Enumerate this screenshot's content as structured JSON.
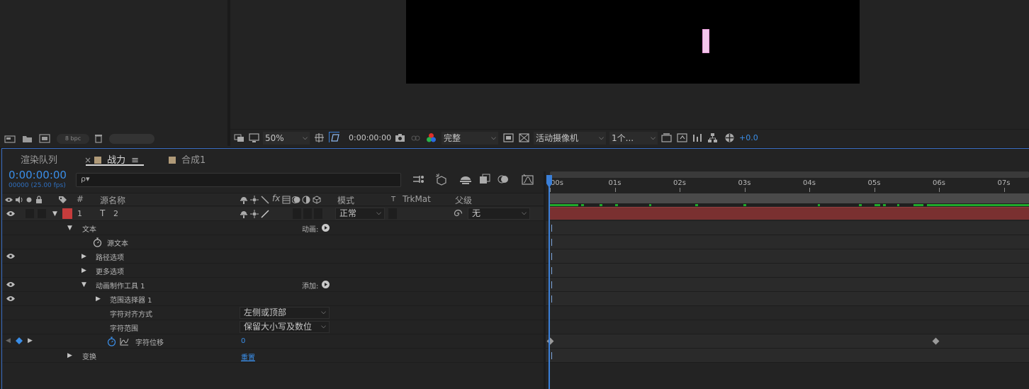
{
  "project": {
    "bpc_label": "8 bpc"
  },
  "viewer": {
    "zoom": "50%",
    "timecode": "0:00:00:00",
    "resolution": "完整",
    "camera": "活动摄像机",
    "views": "1个...",
    "exposure": "+0.0"
  },
  "timeline": {
    "tabs": [
      {
        "label": "渲染队列"
      },
      {
        "label": "战力"
      },
      {
        "label": "合成1"
      }
    ],
    "active_tab_close": "×",
    "active_tab_menu": "≡",
    "timecode": "0:00:00:00",
    "fps": "00000 (25.00 fps)",
    "search_placeholder": "ρ▾",
    "columns": {
      "hash": "#",
      "source_name": "源名称",
      "mode": "模式",
      "t": "T",
      "trkmat": "TrkMat",
      "parent": "父级"
    },
    "layer": {
      "index": "1",
      "type_glyph": "T",
      "name": "2",
      "mode": "正常",
      "parent": "无"
    },
    "rows": {
      "text": "文本",
      "animate_label": "动画:",
      "source_text": "源文本",
      "path_options": "路径选项",
      "more_options": "更多选项",
      "animator": "动画制作工具 1",
      "add_label": "添加:",
      "range_selector": "范围选择器 1",
      "char_alignment": "字符对齐方式",
      "char_alignment_value": "左侧或顶部",
      "char_range": "字符范围",
      "char_range_value": "保留大小写及数位",
      "char_offset": "字符位移",
      "char_offset_value": "0",
      "transform": "变换",
      "reset": "重置"
    },
    "ruler_labels": [
      "00s",
      "01s",
      "02s",
      "03s",
      "04s",
      "05s",
      "06s",
      "07s"
    ],
    "colors": {
      "accent": "#3a8ee8",
      "layer_label": "#c63c3c",
      "layer_bar": "#7a3030",
      "cache": "#1faa2a"
    }
  }
}
